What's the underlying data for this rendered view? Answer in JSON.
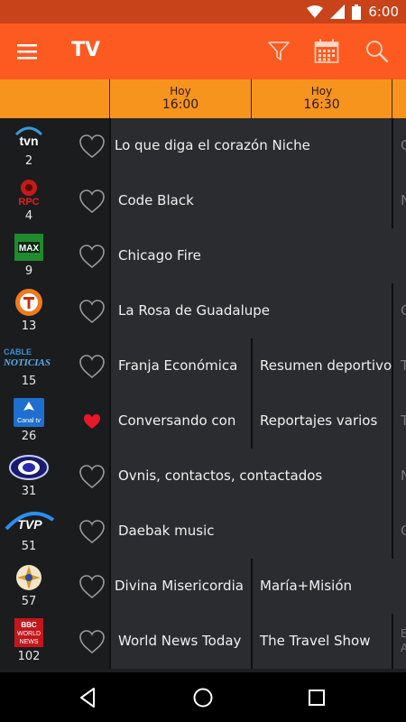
{
  "status": {
    "time": "6:00"
  },
  "app_bar": {
    "title": "TV"
  },
  "time_slots": [
    {
      "day": "Hoy",
      "hour": "16:00"
    },
    {
      "day": "Hoy",
      "hour": "16:30"
    }
  ],
  "channels": [
    {
      "number": "2",
      "logo": "tvn-logo",
      "favorite": false,
      "programs": [
        "Lo que diga el corazón Niche",
        "C"
      ]
    },
    {
      "number": "4",
      "logo": "rpc-logo",
      "favorite": false,
      "programs": [
        "Code Black",
        "N"
      ]
    },
    {
      "number": "9",
      "logo": "tvmax-logo",
      "favorite": false,
      "programs": [
        "Chicago Fire"
      ]
    },
    {
      "number": "13",
      "logo": "telemetro-logo",
      "favorite": false,
      "programs": [
        "La Rosa de Guadalupe",
        "C"
      ]
    },
    {
      "number": "15",
      "logo": "cable-noticias-logo",
      "favorite": false,
      "programs": [
        "Franja Económica",
        "Resumen deportivo",
        "T"
      ]
    },
    {
      "number": "26",
      "logo": "canal-tv-logo",
      "favorite": true,
      "programs": [
        "Conversando con",
        "Reportajes varios",
        "T"
      ]
    },
    {
      "number": "31",
      "logo": "channel-31-logo",
      "favorite": false,
      "programs": [
        "Ovnis, contactos, contactados",
        "N"
      ]
    },
    {
      "number": "51",
      "logo": "tvp-logo",
      "favorite": false,
      "programs": [
        "Daebak music",
        "C"
      ]
    },
    {
      "number": "57",
      "logo": "channel-57-logo",
      "favorite": false,
      "programs": [
        "Divina Misericordia",
        "María+Misión"
      ]
    },
    {
      "number": "102",
      "logo": "bbc-world-news-logo",
      "favorite": false,
      "programs": [
        "World News Today",
        "The Travel Show",
        "E A"
      ]
    }
  ],
  "logo_text": {
    "tvn": "tvn",
    "rpc": "RPC",
    "tvmax": "MAX",
    "cable1": "CABLE",
    "cable2": "NOTICIAS",
    "canal": "Canal tv",
    "tvp": "TVP",
    "bbc1": "BBC",
    "bbc2": "WORLD",
    "bbc3": "NEWS"
  },
  "colors": {
    "app_bar": "#fd5a22",
    "status_bar": "#c9431a",
    "time_header": "#f7941e",
    "favorite_heart": "#e8182a"
  }
}
